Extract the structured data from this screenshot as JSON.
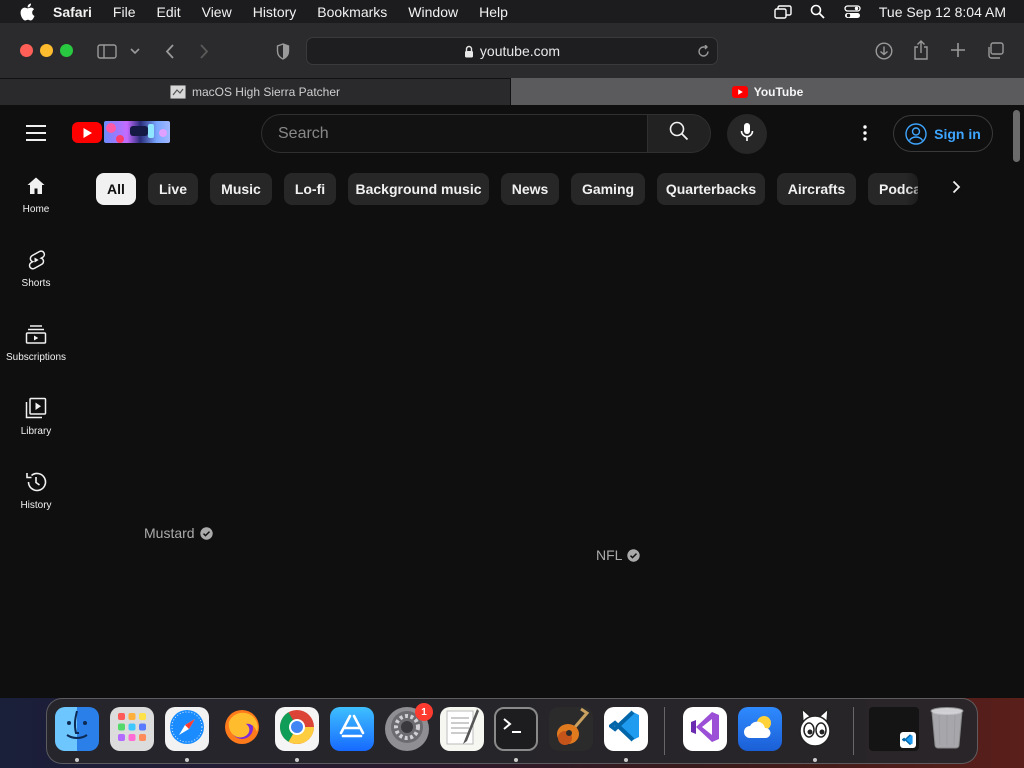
{
  "menubar": {
    "app_name": "Safari",
    "menus": [
      "File",
      "Edit",
      "View",
      "History",
      "Bookmarks",
      "Window",
      "Help"
    ],
    "clock": "Tue Sep 12  8:04 AM",
    "icons": [
      "screen-mirror-icon",
      "spotlight-search-icon",
      "control-center-icon"
    ]
  },
  "toolbar": {
    "url": "youtube.com",
    "icons": [
      "sidebar-icon",
      "back-icon",
      "forward-icon",
      "privacy-shield-icon",
      "reload-icon",
      "downloads-icon",
      "share-icon",
      "new-tab-icon",
      "tab-overview-icon"
    ]
  },
  "tabs": [
    {
      "title": "macOS High Sierra Patcher",
      "active": false
    },
    {
      "title": "YouTube",
      "active": true
    }
  ],
  "youtube": {
    "search_placeholder": "Search",
    "sign_in": "Sign in",
    "sidebar": [
      {
        "label": "Home",
        "icon": "home-icon"
      },
      {
        "label": "Shorts",
        "icon": "shorts-icon"
      },
      {
        "label": "Subscriptions",
        "icon": "subscriptions-icon"
      },
      {
        "label": "Library",
        "icon": "library-icon"
      },
      {
        "label": "History",
        "icon": "history-icon"
      }
    ],
    "chips": [
      "All",
      "Live",
      "Music",
      "Lo-fi",
      "Background music",
      "News",
      "Gaming",
      "Quarterbacks",
      "Aircrafts",
      "Podcasts"
    ],
    "active_chip": "All",
    "channels": [
      "Mustard",
      "NFL"
    ]
  },
  "dock": {
    "apps": [
      "Finder",
      "Launchpad",
      "Safari",
      "Firefox",
      "Chrome",
      "App Store",
      "System Preferences",
      "TextEdit",
      "Terminal",
      "GarageBand",
      "Visual Studio Code",
      "Visual Studio",
      "Weather",
      "Cat",
      "VS Code Window",
      "Trash"
    ],
    "system_preferences_badge": "1"
  },
  "colors": {
    "youtube_red": "#ff0000",
    "link_blue": "#3ea6ff",
    "background": "#0f0f0f",
    "chip": "#272727"
  }
}
